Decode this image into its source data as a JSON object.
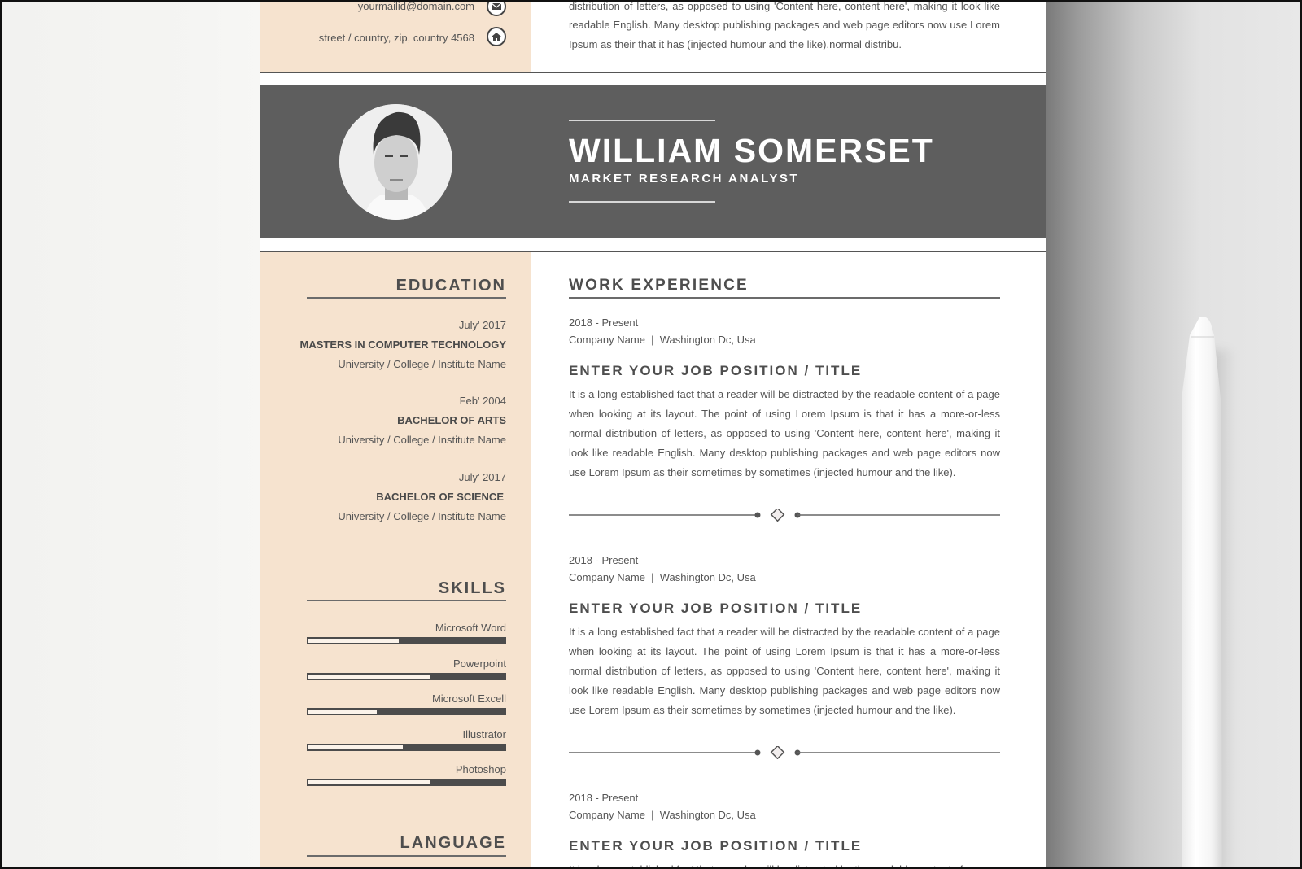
{
  "contact": {
    "email": "yourmailid@domain.com",
    "address": "street / country, zip, country 4568",
    "email_icon": "envelope-icon",
    "address_icon": "home-icon"
  },
  "top_paragraph_tail": "distribution of letters, as opposed to using 'Content here, content here', making it look like readable English. Many desktop publishing packages and web page editors now use Lorem Ipsum as their that it has (injected humour and the like).normal distribu.",
  "header": {
    "name": "WILLIAM SOMERSET",
    "role": "MARKET RESEARCH ANALYST",
    "photo": "profile-photo"
  },
  "education": {
    "heading": "EDUCATION",
    "items": [
      {
        "date": "July' 2017",
        "degree": "MASTERS IN COMPUTER TECHNOLOGY",
        "school": "University / College / Institute Name"
      },
      {
        "date": "Feb' 2004",
        "degree": "BACHELOR OF ARTS",
        "school": "University / College / Institute Name"
      },
      {
        "date": "July' 2017",
        "degree": "BACHELOR OF SCIENCE",
        "school": "University / College / Institute Name"
      }
    ]
  },
  "skills": {
    "heading": "SKILLS",
    "items": [
      {
        "name": "Microsoft Word",
        "level": 0.46
      },
      {
        "name": "Powerpoint",
        "level": 0.62
      },
      {
        "name": "Microsoft Excell",
        "level": 0.35
      },
      {
        "name": "Illustrator",
        "level": 0.48
      },
      {
        "name": "Photoshop",
        "level": 0.62
      }
    ]
  },
  "language": {
    "heading": "LANGUAGE"
  },
  "work": {
    "heading": "WORK EXPERIENCE",
    "items": [
      {
        "period": "2018 - Present",
        "company_line": "Company Name  |  Washington Dc, Usa",
        "title": "ENTER YOUR JOB POSITION / TITLE",
        "description": "It is a long established fact that a reader will be distracted by the readable content of a page when looking at its layout. The point of using Lorem Ipsum is that it has a more-or-less normal distribution of letters, as opposed to using 'Content here, content here', making it look like readable English. Many desktop publishing packages and web page editors now use Lorem Ipsum as their  sometimes by sometimes (injected humour and the like)."
      },
      {
        "period": "2018 - Present",
        "company_line": "Company Name  |  Washington Dc, Usa",
        "title": "ENTER YOUR JOB POSITION / TITLE",
        "description": "It is a long established fact that a reader will be distracted by the readable content of a page when looking at its layout. The point of using Lorem Ipsum is that it has a more-or-less normal distribution of letters, as opposed to using 'Content here, content here', making it look like readable English. Many desktop publishing packages and web page editors now use Lorem Ipsum as their  sometimes by sometimes (injected humour and the like)."
      },
      {
        "period": "2018 - Present",
        "company_line": "Company Name  |  Washington Dc, Usa",
        "title": "ENTER YOUR JOB POSITION / TITLE",
        "description": "It is a long established fact that a reader will be distracted by the readable content of a page"
      }
    ]
  },
  "colors": {
    "sidebar": "#f6e3cf",
    "banner": "#5e5e5e",
    "text": "#555555",
    "heading": "#4e4e4e"
  }
}
